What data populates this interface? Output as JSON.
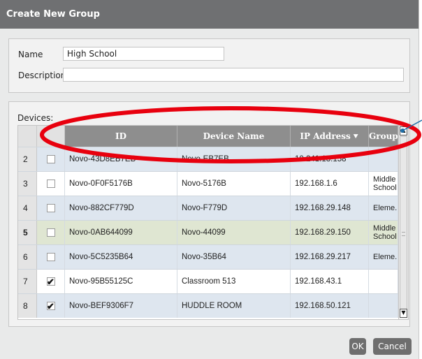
{
  "dialog": {
    "title": "Create New Group",
    "name_label": "Name",
    "name_value": "High School",
    "description_label": "Description",
    "description_value": ""
  },
  "devices": {
    "label": "Devices:",
    "columns": {
      "id": "ID",
      "device_name": "Device Name",
      "ip_address": "IP Address",
      "group": "Group"
    },
    "sort_icon": "chevron-down-icon",
    "rows": [
      {
        "num": "2",
        "checked": "",
        "id": "Novo-43D8EB7EB",
        "name": "Novo-EB7EB",
        "ip": "10.241.13.158",
        "group": ""
      },
      {
        "num": "3",
        "checked": "",
        "id": "Novo-0F0F5176B",
        "name": "Novo-5176B",
        "ip": "192.168.1.6",
        "group": "Middle School"
      },
      {
        "num": "4",
        "checked": "",
        "id": "Novo-882CF779D",
        "name": "Novo-F779D",
        "ip": "192.168.29.148",
        "group": "Eleme..."
      },
      {
        "num": "5",
        "checked": "",
        "id": "Novo-0AB644099",
        "name": "Novo-44099",
        "ip": "192.168.29.150",
        "group": "Middle School"
      },
      {
        "num": "6",
        "checked": "",
        "id": "Novo-5C5235B64",
        "name": "Novo-35B64",
        "ip": "192.168.29.217",
        "group": "Eleme..."
      },
      {
        "num": "7",
        "checked": "✔",
        "id": "Novo-95B55125C",
        "name": "Classroom 513",
        "ip": "192.168.43.1",
        "group": ""
      },
      {
        "num": "8",
        "checked": "✔",
        "id": "Novo-BEF9306F7",
        "name": "HUDDLE ROOM",
        "ip": "192.168.50.121",
        "group": ""
      }
    ]
  },
  "buttons": {
    "ok": "OK",
    "cancel": "Cancel"
  },
  "colors": {
    "titlebar": "#6f7072",
    "header": "#8e8e8e",
    "annotation": "#e8000e",
    "pointer": "#1f6fa8"
  }
}
